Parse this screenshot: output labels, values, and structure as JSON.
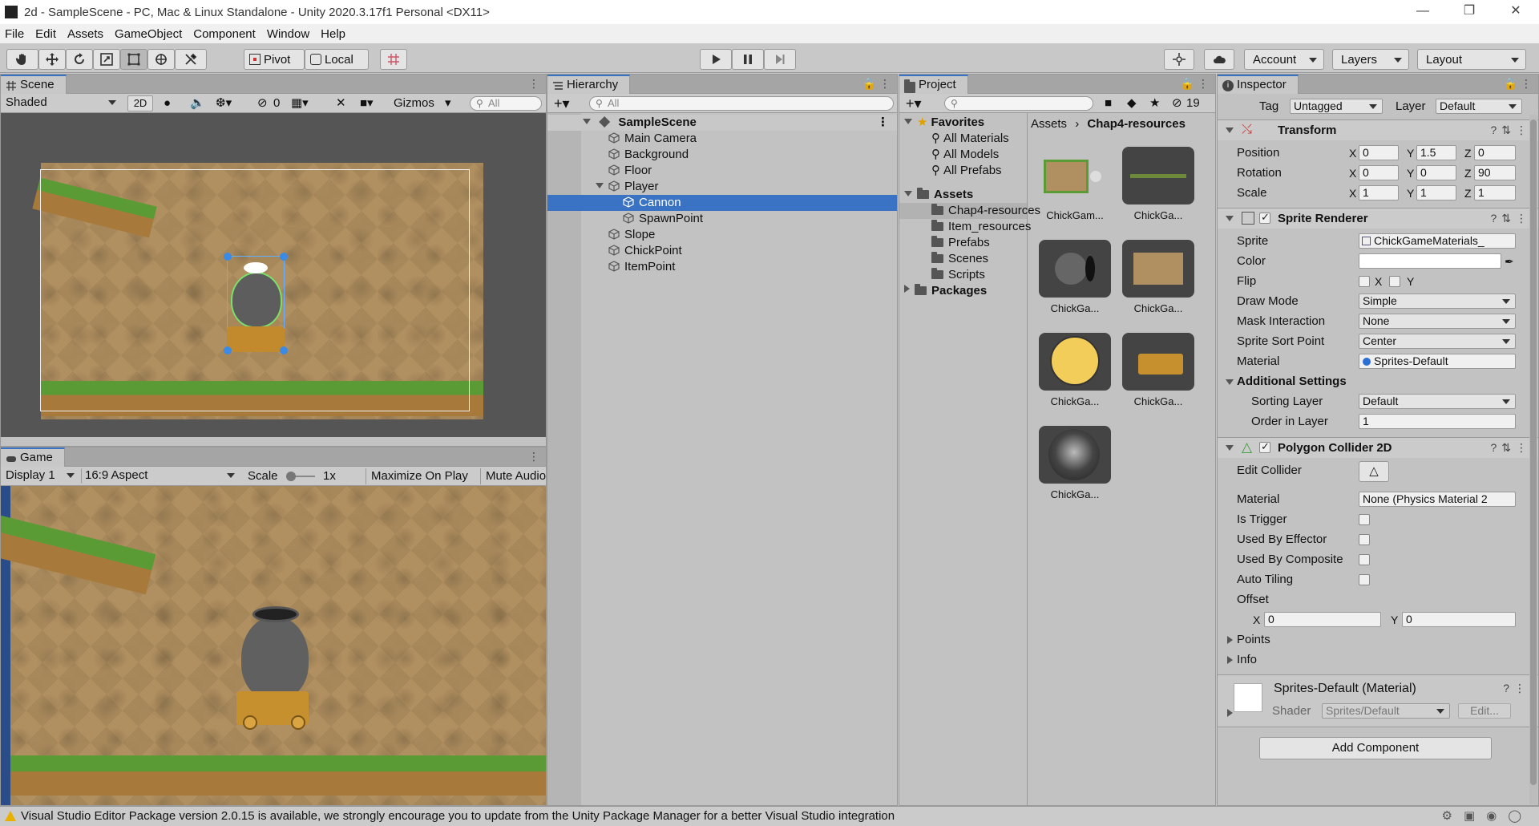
{
  "window": {
    "title": "2d - SampleScene - PC, Mac & Linux Standalone - Unity 2020.3.17f1 Personal <DX11>"
  },
  "menu": [
    "File",
    "Edit",
    "Assets",
    "GameObject",
    "Component",
    "Window",
    "Help"
  ],
  "toolbar": {
    "pivot": "Pivot",
    "local": "Local",
    "account": "Account",
    "layers": "Layers",
    "layout": "Layout"
  },
  "scene": {
    "tab": "Scene",
    "shading": "Shaded",
    "mode2d": "2D",
    "hidden_count": "0",
    "gizmos": "Gizmos",
    "search_placeholder": "All"
  },
  "game": {
    "tab": "Game",
    "display": "Display 1",
    "aspect": "16:9 Aspect",
    "scale_label": "Scale",
    "scale_value": "1x",
    "maximize": "Maximize On Play",
    "mute": "Mute Audio"
  },
  "hierarchy": {
    "tab": "Hierarchy",
    "search_placeholder": "All",
    "scene_name": "SampleScene",
    "items": [
      {
        "label": "Main Camera"
      },
      {
        "label": "Background"
      },
      {
        "label": "Floor"
      },
      {
        "label": "Player"
      },
      {
        "label": "Cannon"
      },
      {
        "label": "SpawnPoint"
      },
      {
        "label": "Slope"
      },
      {
        "label": "ChickPoint"
      },
      {
        "label": "ItemPoint"
      }
    ]
  },
  "project": {
    "tab": "Project",
    "hidden_count": "19",
    "breadcrumb_root": "Assets",
    "breadcrumb_current": "Chap4-resources",
    "favorites": {
      "label": "Favorites",
      "items": [
        "All Materials",
        "All Models",
        "All Prefabs"
      ]
    },
    "assets": {
      "label": "Assets",
      "items": [
        "Chap4-resources",
        "Item_resources",
        "Prefabs",
        "Scenes",
        "Scripts"
      ]
    },
    "packages": "Packages",
    "grid": [
      "ChickGam...",
      "ChickGa...",
      "ChickGa...",
      "ChickGa...",
      "ChickGa...",
      "ChickGa...",
      "ChickGa..."
    ]
  },
  "inspector": {
    "tab": "Inspector",
    "tag_label": "Tag",
    "tag_value": "Untagged",
    "layer_label": "Layer",
    "layer_value": "Default",
    "transform": {
      "title": "Transform",
      "position": {
        "label": "Position",
        "x": "0",
        "y": "1.5",
        "z": "0"
      },
      "rotation": {
        "label": "Rotation",
        "x": "0",
        "y": "0",
        "z": "90"
      },
      "scale": {
        "label": "Scale",
        "x": "1",
        "y": "1",
        "z": "1"
      }
    },
    "sprite_renderer": {
      "title": "Sprite Renderer",
      "sprite_label": "Sprite",
      "sprite_value": "ChickGameMaterials_",
      "color_label": "Color",
      "flip_label": "Flip",
      "flip_x": "X",
      "flip_y": "Y",
      "draw_mode_label": "Draw Mode",
      "draw_mode": "Simple",
      "mask_label": "Mask Interaction",
      "mask": "None",
      "sort_point_label": "Sprite Sort Point",
      "sort_point": "Center",
      "material_label": "Material",
      "material": "Sprites-Default",
      "additional": "Additional Settings",
      "sorting_layer_label": "Sorting Layer",
      "sorting_layer": "Default",
      "order_label": "Order in Layer",
      "order": "1"
    },
    "polygon_collider": {
      "title": "Polygon Collider 2D",
      "edit_label": "Edit Collider",
      "material_label": "Material",
      "material": "None (Physics Material 2",
      "trigger_label": "Is Trigger",
      "effector_label": "Used By Effector",
      "composite_label": "Used By Composite",
      "tiling_label": "Auto Tiling",
      "offset_label": "Offset",
      "offset_x": "0",
      "offset_y": "0",
      "points_label": "Points",
      "info_label": "Info"
    },
    "material_preview": {
      "name": "Sprites-Default (Material)",
      "shader_label": "Shader",
      "shader": "Sprites/Default",
      "edit": "Edit..."
    },
    "add_component": "Add Component"
  },
  "status": {
    "message": "Visual Studio Editor Package version 2.0.15 is available, we strongly encourage you to update from the Unity Package Manager for a better Visual Studio integration"
  }
}
